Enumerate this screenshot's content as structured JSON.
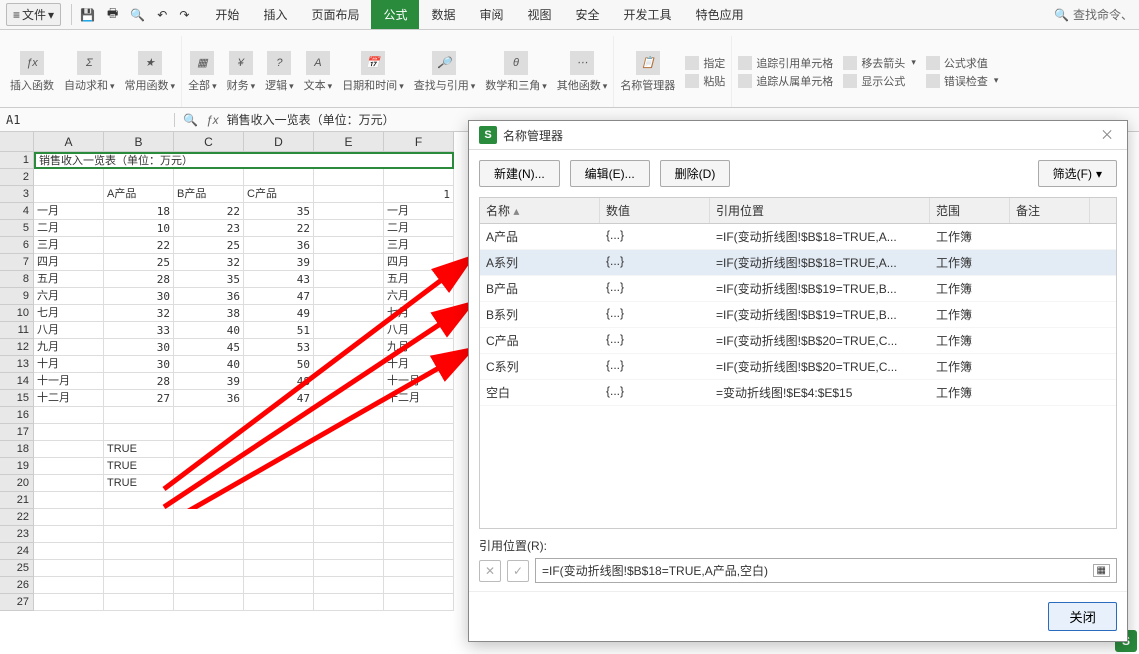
{
  "topbar": {
    "file_label": "文件",
    "tabs": [
      "开始",
      "插入",
      "页面布局",
      "公式",
      "数据",
      "审阅",
      "视图",
      "安全",
      "开发工具",
      "特色应用"
    ],
    "active_tab": "公式",
    "search_placeholder": "查找命令、"
  },
  "ribbon": {
    "items": [
      "插入函数",
      "自动求和",
      "常用函数",
      "全部",
      "财务",
      "逻辑",
      "文本",
      "日期和时间",
      "查找与引用",
      "数学和三角",
      "其他函数",
      "名称管理器",
      "粘贴"
    ],
    "right": {
      "assign": "指定",
      "trace_ref": "追踪引用单元格",
      "trace_dep": "追踪从属单元格",
      "remove_arrows": "移去箭头",
      "show_formula": "显示公式",
      "eval": "公式求值",
      "error_check": "错误检查"
    }
  },
  "cellref": {
    "name_box": "A1",
    "formula": "销售收入一览表（单位：万元）"
  },
  "sheet": {
    "columns": [
      "A",
      "B",
      "C",
      "D",
      "E",
      "F"
    ],
    "title": "销售收入一览表（单位：万元）",
    "headers_row2": {
      "B": "A产品",
      "C": "B产品",
      "D": "C产品",
      "F": "1"
    },
    "data": [
      {
        "A": "一月",
        "B": "18",
        "C": "22",
        "D": "35",
        "F": "一月"
      },
      {
        "A": "二月",
        "B": "10",
        "C": "23",
        "D": "22",
        "F": "二月"
      },
      {
        "A": "三月",
        "B": "22",
        "C": "25",
        "D": "36",
        "F": "三月"
      },
      {
        "A": "四月",
        "B": "25",
        "C": "32",
        "D": "39",
        "F": "四月"
      },
      {
        "A": "五月",
        "B": "28",
        "C": "35",
        "D": "43",
        "F": "五月"
      },
      {
        "A": "六月",
        "B": "30",
        "C": "36",
        "D": "47",
        "F": "六月"
      },
      {
        "A": "七月",
        "B": "32",
        "C": "38",
        "D": "49",
        "F": "七月"
      },
      {
        "A": "八月",
        "B": "33",
        "C": "40",
        "D": "51",
        "F": "八月"
      },
      {
        "A": "九月",
        "B": "30",
        "C": "45",
        "D": "53",
        "F": "九月"
      },
      {
        "A": "十月",
        "B": "30",
        "C": "40",
        "D": "50",
        "F": "十月"
      },
      {
        "A": "十一月",
        "B": "28",
        "C": "39",
        "D": "48",
        "F": "十一月"
      },
      {
        "A": "十二月",
        "B": "27",
        "C": "36",
        "D": "47",
        "F": "十二月"
      }
    ],
    "true_rows": [
      {
        "row": 18,
        "B": "TRUE"
      },
      {
        "row": 19,
        "B": "TRUE"
      },
      {
        "row": 20,
        "B": "TRUE"
      }
    ]
  },
  "dialog": {
    "title": "名称管理器",
    "buttons": {
      "new": "新建(N)...",
      "edit": "编辑(E)...",
      "delete": "删除(D)",
      "filter": "筛选(F)"
    },
    "columns": {
      "name": "名称",
      "value": "数值",
      "ref": "引用位置",
      "scope": "范围",
      "note": "备注"
    },
    "rows": [
      {
        "name": "A产品",
        "value": "{...}",
        "ref": "=IF(变动折线图!$B$18=TRUE,A...",
        "scope": "工作簿"
      },
      {
        "name": "A系列",
        "value": "{...}",
        "ref": "=IF(变动折线图!$B$18=TRUE,A...",
        "scope": "工作簿",
        "selected": true
      },
      {
        "name": "B产品",
        "value": "{...}",
        "ref": "=IF(变动折线图!$B$19=TRUE,B...",
        "scope": "工作簿"
      },
      {
        "name": "B系列",
        "value": "{...}",
        "ref": "=IF(变动折线图!$B$19=TRUE,B...",
        "scope": "工作簿"
      },
      {
        "name": "C产品",
        "value": "{...}",
        "ref": "=IF(变动折线图!$B$20=TRUE,C...",
        "scope": "工作簿"
      },
      {
        "name": "C系列",
        "value": "{...}",
        "ref": "=IF(变动折线图!$B$20=TRUE,C...",
        "scope": "工作簿"
      },
      {
        "name": "空白",
        "value": "{...}",
        "ref": "=变动折线图!$E$4:$E$15",
        "scope": "工作簿"
      }
    ],
    "ref_label": "引用位置(R):",
    "ref_value": "=IF(变动折线图!$B$18=TRUE,A产品,空白)",
    "close": "关闭"
  }
}
